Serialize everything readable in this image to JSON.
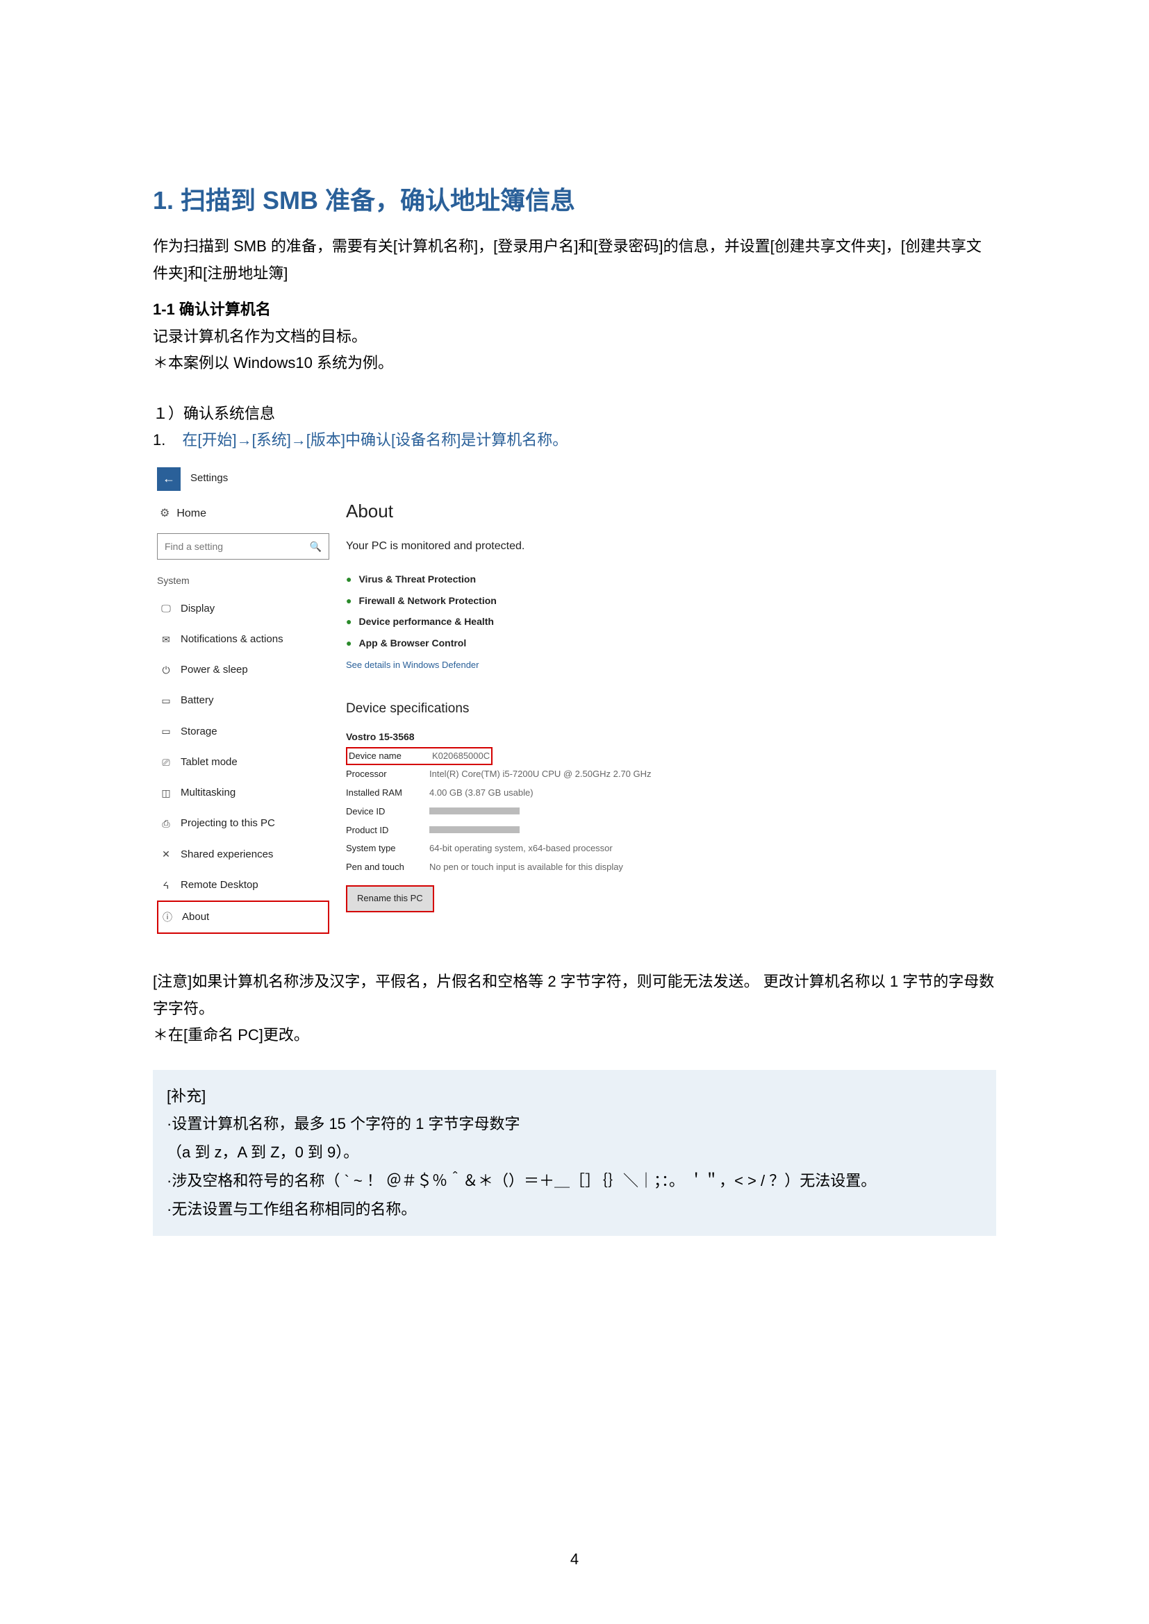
{
  "h1": "1. 扫描到 SMB 准备，确认地址簿信息",
  "intro1": "作为扫描到 SMB 的准备，需要有关[计算机名称]，[登录用户名]和[登录密码]的信息，并设置[创建共享文件夹]，[创建共享文件夹]和[注册地址簿]",
  "sec11": "1-1 确认计算机名",
  "sec11_l1": "记录计算机名作为文档的目标。",
  "sec11_l2": "＊本案例以 Windows10 系统为例。",
  "step_h": "１）确认系统信息",
  "step_1": "1.",
  "step_1_text": "在[开始]→[系统]→[版本]中确认[设备名称]是计算机名称。",
  "ss": {
    "back": "Settings",
    "home": "Home",
    "search_ph": "Find a setting",
    "system": "System",
    "nav": [
      "Display",
      "Notifications & actions",
      "Power & sleep",
      "Battery",
      "Storage",
      "Tablet mode",
      "Multitasking",
      "Projecting to this PC",
      "Shared experiences",
      "Remote Desktop",
      "About"
    ],
    "about": "About",
    "mon": "Your PC is monitored and protected.",
    "prot": [
      "Virus & Threat Protection",
      "Firewall & Network Protection",
      "Device performance & Health",
      "App & Browser Control"
    ],
    "defender": "See details in Windows Defender",
    "spec_h": "Device specifications",
    "model": "Vostro 15-3568",
    "rows": {
      "device_name_k": "Device name",
      "device_name_v": "K020685000C",
      "processor_k": "Processor",
      "processor_v": "Intel(R) Core(TM) i5-7200U CPU @ 2.50GHz   2.70 GHz",
      "ram_k": "Installed RAM",
      "ram_v": "4.00 GB (3.87 GB usable)",
      "devid_k": "Device ID",
      "prodid_k": "Product ID",
      "systype_k": "System type",
      "systype_v": "64-bit operating system, x64-based processor",
      "pen_k": "Pen and touch",
      "pen_v": "No pen or touch input is available for this display"
    },
    "rename": "Rename this PC"
  },
  "note1": "[注意]如果计算机名称涉及汉字，平假名，片假名和空格等 2 字节字符，则可能无法发送。  更改计算机名称以 1 字节的字母数字字符。",
  "note2": "＊在[重命名 PC]更改。",
  "supp_h": "[补充]",
  "supp_1": "·设置计算机名称，最多 15 个字符的 1 字节字母数字",
  "supp_2": "（a 到 z，A 到 Z，0 到 9）。",
  "supp_3": "·涉及空格和符号的名称（ ` ~ ！ ＠＃＄％＾＆＊（）＝＋＿［］｛｝＼｜；：。 ＇＂，< > / ？）无法设置。",
  "supp_4": "·无法设置与工作组名称相同的名称。",
  "page_num": "4"
}
